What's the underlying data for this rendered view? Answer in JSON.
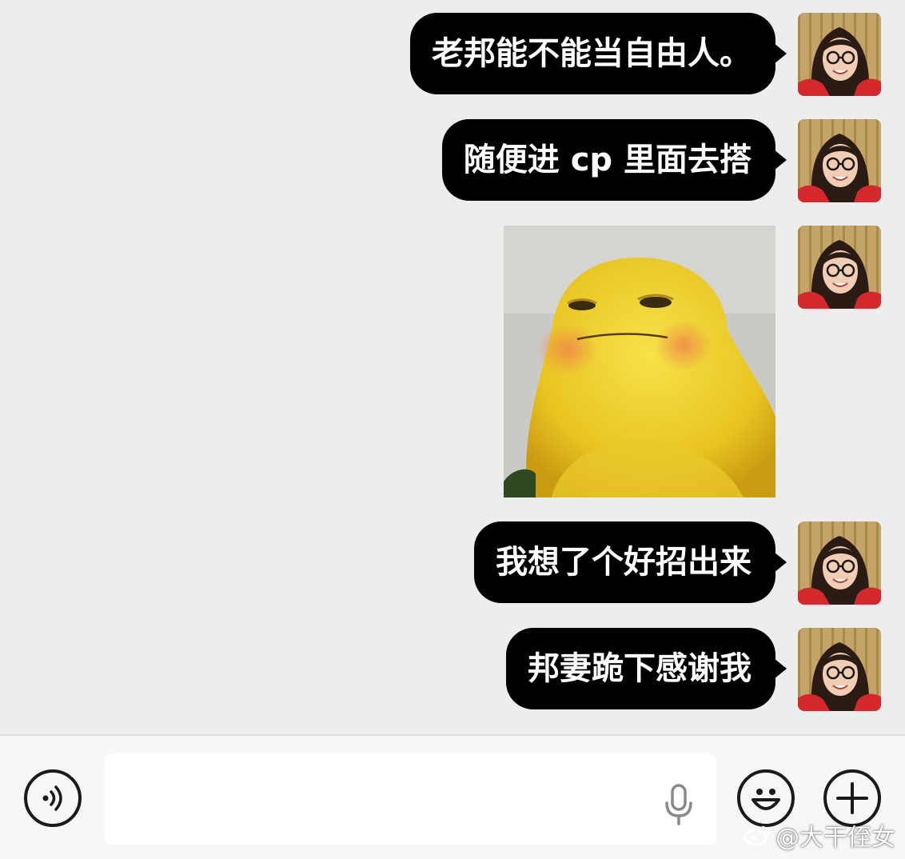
{
  "messages": [
    {
      "type": "text",
      "text": "老邦能不能当自由人。"
    },
    {
      "type": "text",
      "text": "随便进 cp 里面去搭"
    },
    {
      "type": "sticker",
      "sticker_icon": "yellow-frog-sticker"
    },
    {
      "type": "text",
      "text": "我想了个好招出来"
    },
    {
      "type": "text",
      "text": "邦妻跪下感谢我"
    }
  ],
  "input_bar": {
    "voice_icon": "voice-toggle-icon",
    "text_value": "",
    "mic_icon": "microphone-icon",
    "emoji_icon": "emoji-icon",
    "plus_icon": "plus-icon"
  },
  "watermark": {
    "text": "@大干侄女"
  },
  "colors": {
    "chat_background": "#ededed",
    "bubble": "#000000",
    "bubble_text": "#ffffff",
    "input_bar": "#f7f7f7"
  }
}
